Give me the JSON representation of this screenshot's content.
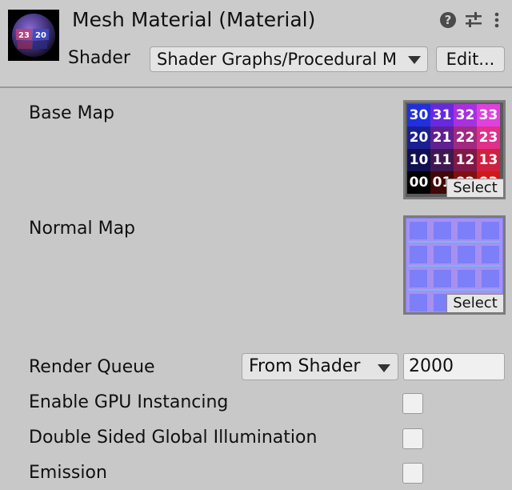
{
  "header": {
    "title": "Mesh Material (Material)",
    "shader_label": "Shader",
    "shader_value": "Shader Graphs/Procedural M",
    "edit_label": "Edit...",
    "help_icon": "question-circle-icon",
    "settings_icon": "sliders-icon",
    "menu_icon": "kebab-menu-icon"
  },
  "properties": {
    "base_map": {
      "label": "Base Map",
      "select_label": "Select",
      "tiles": [
        "30",
        "31",
        "32",
        "33",
        "20",
        "21",
        "22",
        "23",
        "10",
        "11",
        "12",
        "13",
        "00",
        "01",
        "02",
        "03"
      ]
    },
    "normal_map": {
      "label": "Normal Map",
      "select_label": "Select"
    },
    "render_queue": {
      "label": "Render Queue",
      "mode": "From Shader",
      "value": "2000"
    },
    "gpu_instancing": {
      "label": "Enable GPU Instancing",
      "checked": false
    },
    "double_sided_gi": {
      "label": "Double Sided Global Illumination",
      "checked": false
    },
    "emission": {
      "label": "Emission",
      "checked": false
    }
  },
  "preview": {
    "numbers": [
      "23",
      "20"
    ]
  },
  "colors": {
    "background": "#c8c8c8",
    "field": "#e4e4e4",
    "border": "#a5a5a5"
  }
}
